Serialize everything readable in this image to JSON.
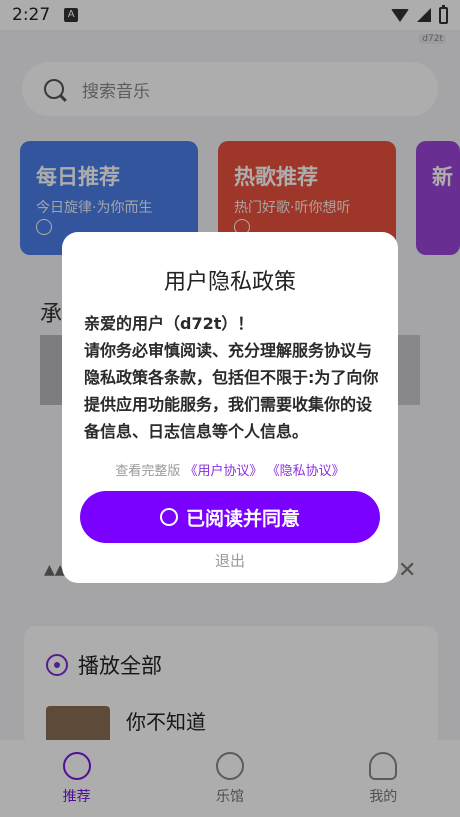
{
  "status_bar": {
    "time": "2:27",
    "badge": "A",
    "watermark": "d72t"
  },
  "search": {
    "placeholder": "搜索音乐"
  },
  "cards": [
    {
      "title": "每日推荐",
      "subtitle": "今日旋律·为你而生"
    },
    {
      "title": "热歌推荐",
      "subtitle": "热门好歌·听你想听"
    },
    {
      "title": "新",
      "subtitle": ""
    }
  ],
  "section_peek": "承",
  "play_all": {
    "label": "播放全部",
    "song_title": "你不知道"
  },
  "tabs": [
    {
      "label": "推荐",
      "icon": "disc-icon",
      "active": true
    },
    {
      "label": "乐馆",
      "icon": "gallery-icon",
      "active": false
    },
    {
      "label": "我的",
      "icon": "person-icon",
      "active": false
    }
  ],
  "dialog": {
    "title": "用户隐私政策",
    "greeting": "亲爱的用户（d72t）！",
    "body": "请你务必审慎阅读、充分理解服务协议与隐私政策各条款，包括但不限于:为了向你提供应用功能服务，我们需要收集你的设备信息、日志信息等个人信息。",
    "links_prefix": "查看完整版",
    "user_agreement": "《用户协议》",
    "privacy_policy": "《隐私协议》",
    "agree_label": "已阅读并同意",
    "exit_label": "退出"
  },
  "colors": {
    "accent": "#7a00ff",
    "blue_card": "#4c7ee8",
    "red_card": "#e9523d"
  }
}
